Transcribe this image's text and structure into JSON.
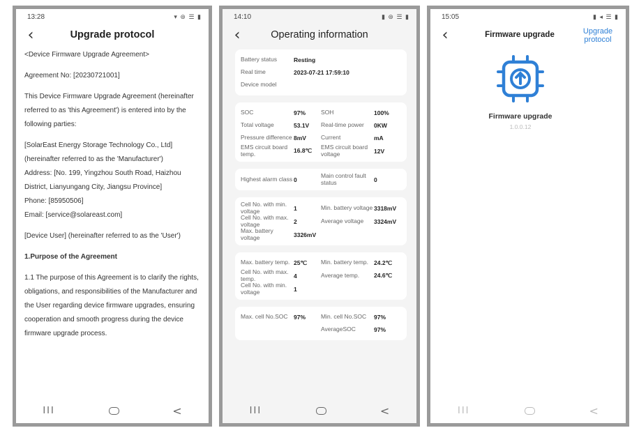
{
  "screen1": {
    "time": "13:28",
    "status_icons": "▾ ⊛ ☰ ▮",
    "title": "Upgrade protocol",
    "paragraphs": [
      "<Device Firmware Upgrade Agreement>",
      "Agreement No: [20230721001]",
      "This Device Firmware Upgrade Agreement (hereinafter referred to as 'this Agreement') is entered into by the following parties:",
      "[SolarEast Energy Storage Technology Co., Ltd] (hereinafter referred to as the 'Manufacturer')",
      "Address: [No. 199, Yingzhou South Road, Haizhou District, Lianyungang City, Jiangsu Province]",
      "Phone: [85950506]",
      "Email: [service@solareast.com]",
      "[Device User] (hereinafter referred to as the 'User')",
      "1.Purpose of the Agreement",
      "1.1 The purpose of this Agreement is to clarify the rights, obligations, and responsibilities of the Manufacturer and the User regarding device firmware upgrades, ensuring cooperation and smooth progress during the device firmware upgrade process."
    ]
  },
  "screen2": {
    "time": "14:10",
    "status_icons": "▮ ⊛ ☰ ▮",
    "title": "Operating information",
    "info": [
      {
        "label": "Battery status",
        "value": "Resting"
      },
      {
        "label": "Real time",
        "value": "2023-07-21 17:59:10"
      },
      {
        "label": "Device model",
        "value": ""
      }
    ],
    "card2": [
      [
        {
          "label": "SOC",
          "value": "97%"
        },
        {
          "label": "SOH",
          "value": "100%"
        }
      ],
      [
        {
          "label": "Total voltage",
          "value": "53.1V"
        },
        {
          "label": "Real-time power",
          "value": "0KW"
        }
      ],
      [
        {
          "label": "Pressure difference",
          "value": "8mV"
        },
        {
          "label": "Current",
          "value": "mA"
        }
      ],
      [
        {
          "label": "EMS circuit board temp.",
          "value": "16.8℃"
        },
        {
          "label": "EMS circuit board voltage",
          "value": "12V"
        }
      ]
    ],
    "card3": [
      [
        {
          "label": "Highest alarm class",
          "value": "0"
        },
        {
          "label": "Main control fault status",
          "value": "0"
        }
      ]
    ],
    "card4": [
      [
        {
          "label": "Cell No. with min. voltage",
          "value": "1"
        },
        {
          "label": "Min. battery voltage",
          "value": "3318mV"
        }
      ],
      [
        {
          "label": "Cell No. with max. voltage",
          "value": "2"
        },
        {
          "label": "Average voltage",
          "value": "3324mV"
        }
      ],
      [
        {
          "label": "Max. battery voltage",
          "value": "3326mV"
        }
      ]
    ],
    "card5": [
      [
        {
          "label": "Max. battery temp.",
          "value": "25℃"
        },
        {
          "label": "Min. battery temp.",
          "value": "24.2℃"
        }
      ],
      [
        {
          "label": "Cell No. with max. temp.",
          "value": "4"
        },
        {
          "label": "Average temp.",
          "value": "24.6℃"
        }
      ],
      [
        {
          "label": "Cell No. with min. voltage",
          "value": "1"
        }
      ]
    ],
    "card6": [
      [
        {
          "label": "Max. cell No.SOC",
          "value": "97%"
        },
        {
          "label": "Min. cell No.SOC",
          "value": "97%"
        }
      ],
      [
        {
          "label": "",
          "value": ""
        },
        {
          "label": "AverageSOC",
          "value": "97%"
        }
      ]
    ]
  },
  "screen3": {
    "time": "15:05",
    "status_icons": "▮ ◂ ☰ ▮",
    "title": "Firmware upgrade",
    "link": "Upgrade protocol",
    "firmware_label": "Firmware upgrade",
    "version": "1.0.0.12",
    "icon": "chip-upload-icon",
    "accent": "#2f80d6"
  },
  "nav": {
    "recent": "III",
    "back": "<"
  }
}
